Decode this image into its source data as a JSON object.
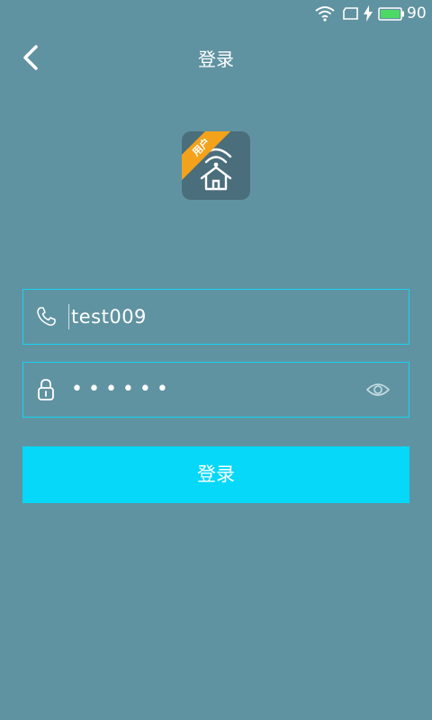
{
  "status_bar": {
    "battery_level": "90",
    "icons": [
      "wifi-icon",
      "sim-icon",
      "charging-icon",
      "battery-icon"
    ]
  },
  "header": {
    "title": "登录",
    "back_icon": "chevron-left-icon"
  },
  "logo": {
    "badge_text": "用户",
    "icon": "home-wifi-icon"
  },
  "form": {
    "phone": {
      "value": "test009",
      "icon": "phone-icon"
    },
    "password": {
      "value": "••••••",
      "icon": "lock-icon",
      "toggle_icon": "eye-icon"
    }
  },
  "login_button": {
    "label": "登录"
  },
  "colors": {
    "background": "#6093a1",
    "accent": "#05d8f8",
    "field_border": "#16d2f2",
    "badge": "#f3a21c",
    "battery": "#4cd964"
  }
}
